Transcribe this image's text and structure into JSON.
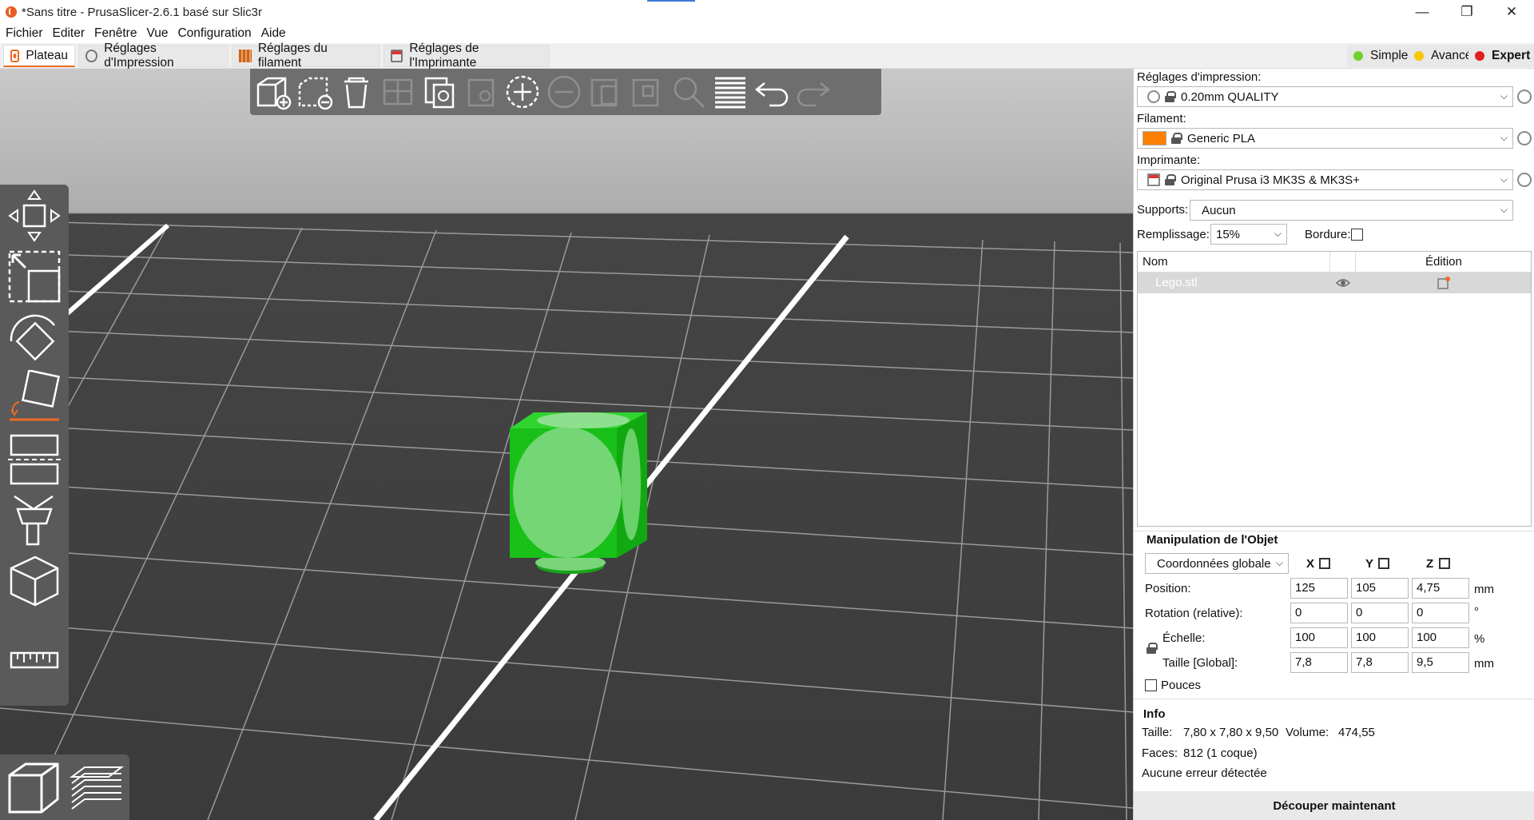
{
  "window": {
    "title": "*Sans titre - PrusaSlicer-2.6.1 basé sur Slic3r",
    "minimize": "—",
    "maximize": "❐",
    "close": "✕"
  },
  "menu": [
    "Fichier",
    "Editer",
    "Fenêtre",
    "Vue",
    "Configuration",
    "Aide"
  ],
  "tabs": [
    {
      "label": "Plateau"
    },
    {
      "label": "Réglages d'Impression"
    },
    {
      "label": "Réglages du filament"
    },
    {
      "label": "Réglages de l'Imprimante"
    }
  ],
  "modes": [
    {
      "label": "Simple",
      "color": "#6fd22b"
    },
    {
      "label": "Avancé",
      "color": "#f2c70a"
    },
    {
      "label": "Expert",
      "color": "#e01e1e"
    }
  ],
  "panel": {
    "print_label": "Réglages d'impression:",
    "print_value": "0.20mm QUALITY",
    "filament_label": "Filament:",
    "filament_value": "Generic PLA",
    "filament_color": "#ff8000",
    "printer_label": "Imprimante:",
    "printer_value": "Original Prusa i3 MK3S & MK3S+",
    "supports_label": "Supports:",
    "supports_value": "Aucun",
    "infill_label": "Remplissage:",
    "infill_value": "15%",
    "brim_label": "Bordure:"
  },
  "objects": {
    "col_name": "Nom",
    "col_edit": "Édition",
    "rows": [
      {
        "name": "Lego.stl"
      }
    ]
  },
  "manip": {
    "title": "Manipulation de l'Objet",
    "coords": "Coordonnées globales",
    "x": "X",
    "y": "Y",
    "z": "Z",
    "position_label": "Position:",
    "position": [
      "125",
      "105",
      "4,75"
    ],
    "position_unit": "mm",
    "rotation_label": "Rotation (relative):",
    "rotation": [
      "0",
      "0",
      "0"
    ],
    "rotation_unit": "°",
    "scale_label": "Échelle:",
    "scale": [
      "100",
      "100",
      "100"
    ],
    "scale_unit": "%",
    "size_label": "Taille [Global]:",
    "size": [
      "7,8",
      "7,8",
      "9,5"
    ],
    "size_unit": "mm",
    "inches_label": "Pouces"
  },
  "info": {
    "title": "Info",
    "size_label": "Taille:",
    "size_value": "7,80 x 7,80 x 9,50",
    "volume_label": "Volume:",
    "volume_value": "474,55",
    "faces_label": "Faces:",
    "faces_value": "812 (1 coque)",
    "errors": "Aucune erreur détectée"
  },
  "slice_button": "Découper maintenant",
  "colors": {
    "accent": "#ed6b21",
    "object": "#19c219"
  }
}
